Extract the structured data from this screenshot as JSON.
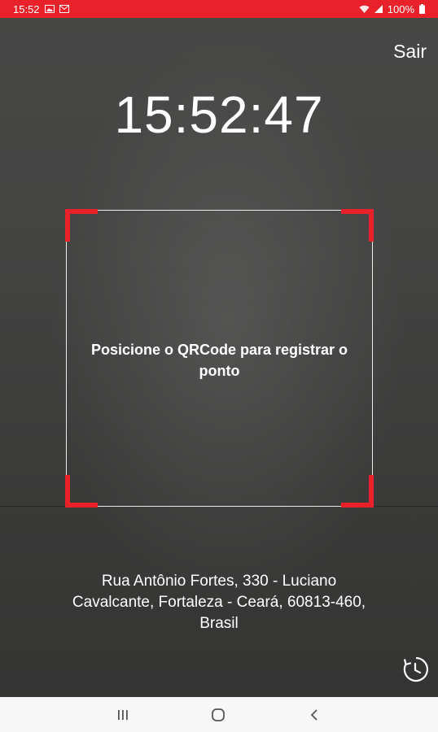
{
  "status_bar": {
    "time": "15:52",
    "battery": "100%",
    "left_icons": [
      "gallery-icon",
      "gmail-icon"
    ],
    "right_icons": [
      "wifi-icon",
      "signal-icon",
      "battery-icon"
    ],
    "background_color": "#e8212b"
  },
  "header": {
    "logout_label": "Sair"
  },
  "clock": {
    "time": "15:52:47"
  },
  "scanner": {
    "instruction": "Posicione o QRCode para registrar o ponto",
    "accent_color": "#e8212b"
  },
  "location": {
    "address": "Rua Antônio Fortes, 330 - Luciano Cavalcante, Fortaleza - Ceará, 60813-460, Brasil"
  },
  "actions": {
    "history_icon": "history-icon"
  },
  "nav_bar": {
    "buttons": [
      "recents-icon",
      "home-icon",
      "back-icon"
    ]
  }
}
